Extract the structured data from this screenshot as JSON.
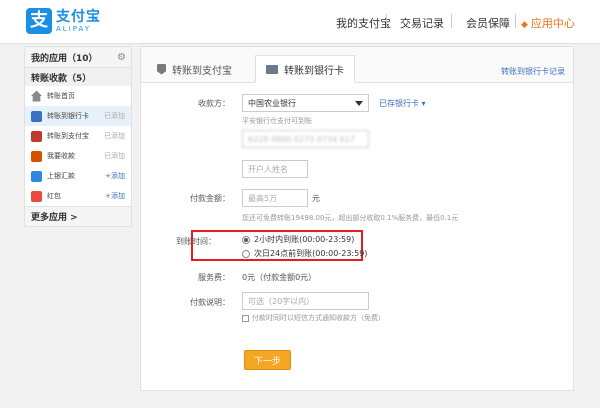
{
  "header": {
    "logo_cn": "支付宝",
    "logo_en": "ALIPAY",
    "nav": [
      "我的支付宝",
      "交易记录",
      "会员保障",
      "应用中心"
    ],
    "active_nav": "应用中心"
  },
  "sidebar": {
    "my_apps": "我的应用（10）",
    "group": "转账收款（5）",
    "items": [
      {
        "label": "转账首页",
        "tag": ""
      },
      {
        "label": "转账到银行卡",
        "tag": "已添加"
      },
      {
        "label": "转账到支付宝",
        "tag": "已添加"
      },
      {
        "label": "我要收款",
        "tag": "已添加"
      },
      {
        "label": "上银汇款",
        "tag": "+添加"
      },
      {
        "label": "红包",
        "tag": "+添加"
      }
    ],
    "more": "更多应用 >"
  },
  "tabs": {
    "tab1": "转账到支付宝",
    "tab2": "转账到银行卡",
    "record_link": "转账到银行卡记录"
  },
  "form": {
    "payee_label": "收款方：",
    "bank_value": "中国农业银行",
    "saved_cards": "已存银行卡",
    "bank_hint": "平安银行仓支付可到账",
    "card_number": "6228 4800 0273 0734 617",
    "name_placeholder": "开户人姓名",
    "amount_label": "付款金额：",
    "amount_placeholder": "最高5万",
    "amount_unit": "元",
    "amount_hint": "您还可免费转账19498.00元，超出部分收取0.1%服务费，最低0.1元",
    "arrival_label": "到账时间：",
    "arrival_option1": "2小时内到账(00:00-23:59)",
    "arrival_option2": "次日24点前到账(00:00-23:59)",
    "fee_label": "服务费：",
    "fee_value": "0元（付款金额0元）",
    "note_label": "付款说明：",
    "note_placeholder": "可选（20字以内）",
    "sms_notice": "付款时同时以短信方式通知收款方（免费）",
    "next_button": "下一步"
  },
  "colors": {
    "brand": "#1a8fe3",
    "accent": "#f2711c",
    "button": "#f5a623",
    "highlight": "#e02020"
  }
}
